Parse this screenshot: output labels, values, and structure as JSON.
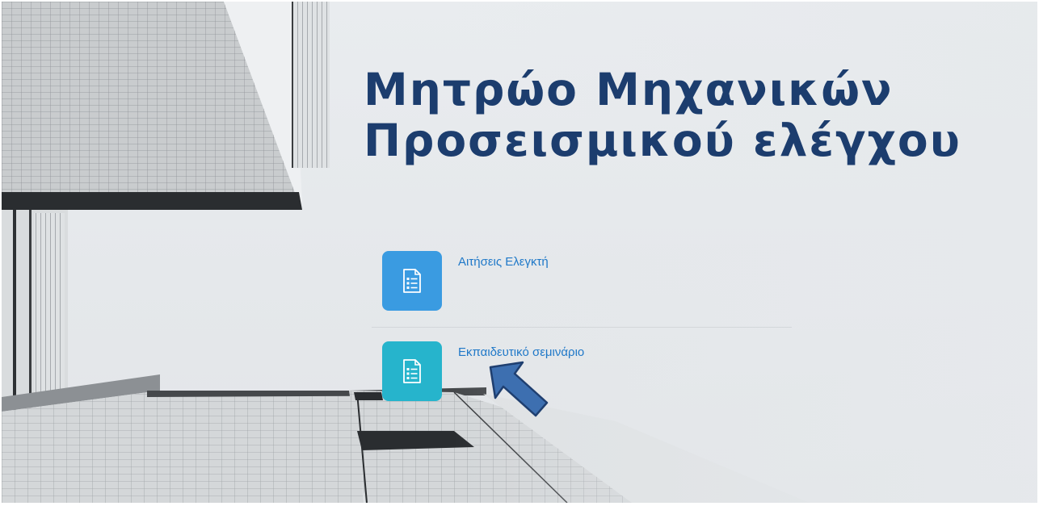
{
  "page": {
    "title_line1": "Μητρώο Μηχανικών",
    "title_line2": "Προσεισμικού ελέγχου"
  },
  "menu": {
    "items": [
      {
        "label": "Αιτήσεις Ελεγκτή",
        "icon": "document-list-icon",
        "color": "#3a9be1"
      },
      {
        "label": "Εκπαιδευτικό σεμινάριο",
        "icon": "document-list-icon",
        "color": "#26b4cc"
      }
    ]
  },
  "annotation": {
    "icon": "arrow-pointer-icon",
    "color": "#3d6fb0"
  }
}
